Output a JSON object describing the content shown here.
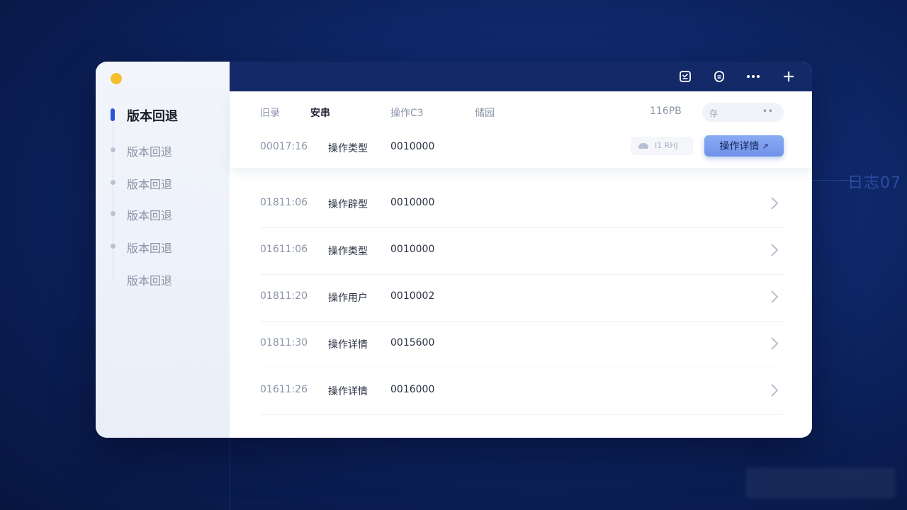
{
  "background": {
    "side_text": "日志07"
  },
  "sidebar": {
    "items": [
      {
        "label": "版本回退",
        "active": true
      },
      {
        "label": "版本回退"
      },
      {
        "label": "版本回退"
      },
      {
        "label": "版本回退"
      },
      {
        "label": "版本回退"
      },
      {
        "label": "版本回退"
      }
    ]
  },
  "titlebar": {
    "icons": [
      "save-icon",
      "shield-icon",
      "more-icon",
      "add-icon"
    ]
  },
  "header": {
    "columns": [
      "旧录",
      "安串",
      "操作C3",
      "储园"
    ],
    "size": "116PB",
    "pill_text": "存",
    "pill_more": "••",
    "first_row": {
      "time": "00017:16",
      "op": "操作类型",
      "code": "0010000"
    },
    "chip_text": "I1  RHJ",
    "primary_button": "操作详情",
    "primary_button_icon": "↗"
  },
  "rows": [
    {
      "time": "01811:06",
      "op": "操作辟型",
      "code": "0010000"
    },
    {
      "time": "01611:06",
      "op": "操作类型",
      "code": "0010000"
    },
    {
      "time": "01811:20",
      "op": "操作用户",
      "code": "0010002"
    },
    {
      "time": "01811:30",
      "op": "操作详情",
      "code": "0015600"
    },
    {
      "time": "01611:26",
      "op": "操作详情",
      "code": "0016000"
    }
  ],
  "colors": {
    "accent": "#2c52d6",
    "titlebar": "#142a68",
    "window_dot": "#f5c02e",
    "button": "#7a9cef"
  }
}
